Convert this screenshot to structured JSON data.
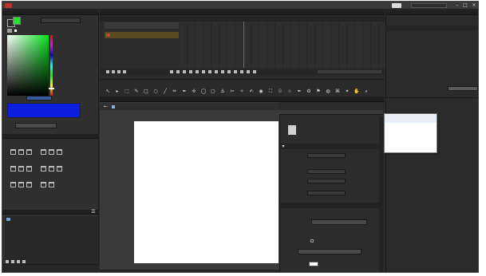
{
  "app": {
    "title": ""
  },
  "menubar": {
    "items": [
      {
        "label": ""
      },
      {
        "label": ""
      },
      {
        "label": ""
      },
      {
        "label": ""
      },
      {
        "label": ""
      },
      {
        "label": ""
      },
      {
        "label": ""
      },
      {
        "label": ""
      },
      {
        "label": ""
      },
      {
        "label": ""
      },
      {
        "label": ""
      }
    ],
    "workspace_label": ""
  },
  "timeline": {
    "tab": "",
    "layer_name": "",
    "status": ""
  },
  "color_panel": {
    "tab": "",
    "mode_select": "",
    "hsb": [
      {
        "label": "",
        "value": ""
      },
      {
        "label": "",
        "value": ""
      },
      {
        "label": "",
        "value": ""
      }
    ],
    "rgb": [
      {
        "label": "",
        "value": ""
      },
      {
        "label": "",
        "value": ""
      },
      {
        "label": "",
        "value": ""
      }
    ],
    "hex_label": "",
    "hex_value": "",
    "alpha_label": "",
    "add_swatch": "",
    "swatch_color": "#0b1ee0"
  },
  "tools_panel": {
    "tabs": [
      {
        "label": ""
      },
      {
        "label": ""
      },
      {
        "label": ""
      }
    ],
    "sections": [
      {
        "label": ""
      },
      {
        "label": ""
      },
      {
        "label": ""
      },
      {
        "label": ""
      }
    ],
    "footer": ""
  },
  "library": {
    "tab": "",
    "item": "",
    "footer": ""
  },
  "toolbox": {
    "tab": ""
  },
  "stage": {
    "tab": "",
    "scene": "",
    "bottom_tab": ""
  },
  "properties": {
    "tab": "",
    "doc_type": "",
    "doc_name": "",
    "section_label": "",
    "rows": [
      {
        "label": "",
        "value": ""
      },
      {
        "label": "",
        "value": ""
      },
      {
        "label": "",
        "value": ""
      },
      {
        "label": "",
        "value": ""
      }
    ],
    "section2_label": "",
    "fps_label": "",
    "fps_value": "",
    "size_label": "",
    "size_w": "",
    "size_h": "",
    "check_label": "",
    "bottom_label": ""
  },
  "right_panel": {
    "tab": "",
    "sub": "",
    "field": ""
  },
  "dropdown": {
    "options": [
      {
        "label": ""
      },
      {
        "label": ""
      },
      {
        "label": ""
      },
      {
        "label": ""
      }
    ]
  }
}
